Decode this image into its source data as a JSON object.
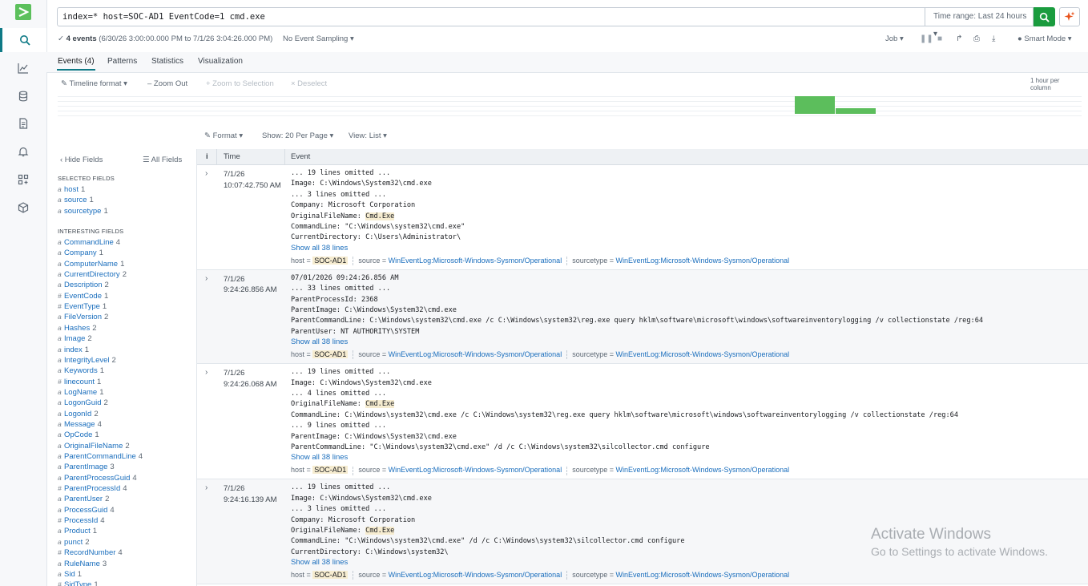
{
  "search": {
    "query": "index=* host=SOC-AD1 EventCode=1 cmd.exe",
    "time_range": "Time range: Last 24 hours ▾"
  },
  "status": {
    "check": "✓",
    "events_count": "4 events",
    "events_range": "(6/30/26 3:00:00.000 PM to 7/1/26 3:04:26.000 PM)",
    "sampling": "No Event Sampling ▾",
    "job": "Job ▾",
    "smart_mode": "Smart Mode ▾"
  },
  "tabs": [
    "Events (4)",
    "Patterns",
    "Statistics",
    "Visualization"
  ],
  "timeline": {
    "format": "Timeline format ▾",
    "zoom_out": "– Zoom Out",
    "zoom_selection": "+ Zoom to Selection",
    "deselect": "× Deselect",
    "per_column": "1 hour per column",
    "bar_values": [
      3,
      1
    ]
  },
  "results_toolbar": {
    "format": "Format ▾",
    "show": "Show: 20 Per Page ▾",
    "view": "View: List ▾"
  },
  "fields_panel": {
    "hide_fields": "‹ Hide Fields",
    "all_fields": "All Fields",
    "selected_header": "SELECTED FIELDS",
    "interesting_header": "INTERESTING FIELDS",
    "selected": [
      {
        "t": "a",
        "name": "host",
        "count": "1"
      },
      {
        "t": "a",
        "name": "source",
        "count": "1"
      },
      {
        "t": "a",
        "name": "sourcetype",
        "count": "1"
      }
    ],
    "interesting": [
      {
        "t": "a",
        "name": "CommandLine",
        "count": "4"
      },
      {
        "t": "a",
        "name": "Company",
        "count": "1"
      },
      {
        "t": "a",
        "name": "ComputerName",
        "count": "1"
      },
      {
        "t": "a",
        "name": "CurrentDirectory",
        "count": "2"
      },
      {
        "t": "a",
        "name": "Description",
        "count": "2"
      },
      {
        "t": "#",
        "name": "EventCode",
        "count": "1"
      },
      {
        "t": "#",
        "name": "EventType",
        "count": "1"
      },
      {
        "t": "a",
        "name": "FileVersion",
        "count": "2"
      },
      {
        "t": "a",
        "name": "Hashes",
        "count": "2"
      },
      {
        "t": "a",
        "name": "Image",
        "count": "2"
      },
      {
        "t": "a",
        "name": "index",
        "count": "1"
      },
      {
        "t": "a",
        "name": "IntegrityLevel",
        "count": "2"
      },
      {
        "t": "a",
        "name": "Keywords",
        "count": "1"
      },
      {
        "t": "#",
        "name": "linecount",
        "count": "1"
      },
      {
        "t": "a",
        "name": "LogName",
        "count": "1"
      },
      {
        "t": "a",
        "name": "LogonGuid",
        "count": "2"
      },
      {
        "t": "a",
        "name": "LogonId",
        "count": "2"
      },
      {
        "t": "a",
        "name": "Message",
        "count": "4"
      },
      {
        "t": "a",
        "name": "OpCode",
        "count": "1"
      },
      {
        "t": "a",
        "name": "OriginalFileName",
        "count": "2"
      },
      {
        "t": "a",
        "name": "ParentCommandLine",
        "count": "4"
      },
      {
        "t": "a",
        "name": "ParentImage",
        "count": "3"
      },
      {
        "t": "a",
        "name": "ParentProcessGuid",
        "count": "4"
      },
      {
        "t": "#",
        "name": "ParentProcessId",
        "count": "4"
      },
      {
        "t": "a",
        "name": "ParentUser",
        "count": "2"
      },
      {
        "t": "a",
        "name": "ProcessGuid",
        "count": "4"
      },
      {
        "t": "#",
        "name": "ProcessId",
        "count": "4"
      },
      {
        "t": "a",
        "name": "Product",
        "count": "1"
      },
      {
        "t": "a",
        "name": "punct",
        "count": "2"
      },
      {
        "t": "#",
        "name": "RecordNumber",
        "count": "4"
      },
      {
        "t": "a",
        "name": "RuleName",
        "count": "3"
      },
      {
        "t": "a",
        "name": "Sid",
        "count": "1"
      },
      {
        "t": "#",
        "name": "SidType",
        "count": "1"
      }
    ]
  },
  "events_table": {
    "col_info": "i",
    "col_time": "Time",
    "col_event": "Event",
    "show_all": "Show all 38 lines",
    "meta_host_label": "host =",
    "meta_source_label": "source =",
    "meta_sourcetype_label": "sourcetype =",
    "host": "SOC-AD1",
    "source": "WinEventLog:Microsoft-Windows-Sysmon/Operational",
    "sourcetype": "WinEventLog:Microsoft-Windows-Sysmon/Operational",
    "rows": [
      {
        "date": "7/1/26",
        "time": "10:07:42.750 AM",
        "lines": [
          "... 19 lines omitted ...",
          "Image: C:\\Windows\\System32\\cmd.exe",
          "... 3 lines omitted ...",
          "Company: Microsoft Corporation",
          "OriginalFileName: |Cmd.Exe|",
          "CommandLine: \"C:\\Windows\\system32\\cmd.exe\"",
          "CurrentDirectory: C:\\Users\\Administrator\\"
        ]
      },
      {
        "date": "7/1/26",
        "time": "9:24:26.856 AM",
        "lines": [
          "07/01/2026 09:24:26.856 AM",
          "... 33 lines omitted ...",
          "ParentProcessId: 2368",
          "ParentImage: C:\\Windows\\System32\\cmd.exe",
          "ParentCommandLine: C:\\Windows\\system32\\cmd.exe /c C:\\Windows\\system32\\reg.exe query hklm\\software\\microsoft\\windows\\softwareinventorylogging /v collectionstate /reg:64",
          "ParentUser: NT AUTHORITY\\SYSTEM"
        ]
      },
      {
        "date": "7/1/26",
        "time": "9:24:26.068 AM",
        "lines": [
          "... 19 lines omitted ...",
          "Image: C:\\Windows\\System32\\cmd.exe",
          "... 4 lines omitted ...",
          "OriginalFileName: |Cmd.Exe|",
          "CommandLine: C:\\Windows\\system32\\cmd.exe /c C:\\Windows\\system32\\reg.exe query hklm\\software\\microsoft\\windows\\softwareinventorylogging /v collectionstate /reg:64",
          "... 9 lines omitted ...",
          "ParentImage: C:\\Windows\\System32\\cmd.exe",
          "ParentCommandLine: \"C:\\Windows\\system32\\cmd.exe\" /d /c C:\\Windows\\system32\\silcollector.cmd configure"
        ]
      },
      {
        "date": "7/1/26",
        "time": "9:24:16.139 AM",
        "lines": [
          "... 19 lines omitted ...",
          "Image: C:\\Windows\\System32\\cmd.exe",
          "... 3 lines omitted ...",
          "Company: Microsoft Corporation",
          "OriginalFileName: |Cmd.Exe|",
          "CommandLine: \"C:\\Windows\\system32\\cmd.exe\" /d /c C:\\Windows\\system32\\silcollector.cmd configure",
          "CurrentDirectory: C:\\Windows\\system32\\"
        ]
      }
    ]
  },
  "watermark": {
    "line1": "Activate Windows",
    "line2": "Go to Settings to activate Windows."
  },
  "colors": {
    "accent": "#1a9c3e",
    "link": "#1a6ebd",
    "bar": "#5cbe5c",
    "highlight": "#f6ecd0"
  }
}
